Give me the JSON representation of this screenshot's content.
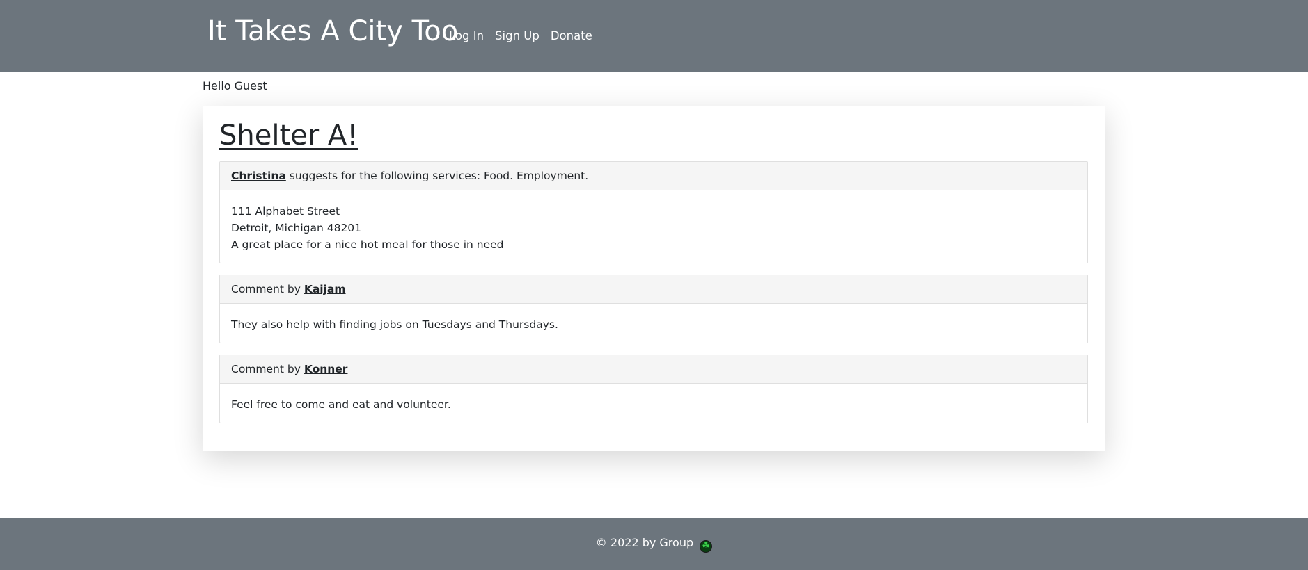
{
  "navbar": {
    "brand": "It Takes A City Too",
    "links": [
      "Log In",
      "Sign Up",
      "Donate"
    ]
  },
  "greeting": "Hello Guest",
  "shelter": {
    "title": "Shelter A!",
    "suggestion": {
      "user": "Christina",
      "text": "suggests for the following services: Food. Employment.",
      "address_line1": "111 Alphabet Street",
      "address_line2": "Detroit, Michigan 48201",
      "description": "A great place for a nice hot meal for those in need"
    }
  },
  "comments": [
    {
      "prefix": "Comment by",
      "user": "Kaijam",
      "text": "They also help with finding jobs on Tuesdays and Thursdays."
    },
    {
      "prefix": "Comment by",
      "user": "Konner",
      "text": "Feel free to come and eat and volunteer."
    }
  ],
  "footer": {
    "text": "© 2022 by Group",
    "icon": "clover-icon",
    "icon_glyph": "☘"
  },
  "colors": {
    "navbar_bg": "#6c757d",
    "footer_bg": "#6c757d",
    "text": "#212529",
    "panel_header_bg": "#f5f5f5"
  }
}
